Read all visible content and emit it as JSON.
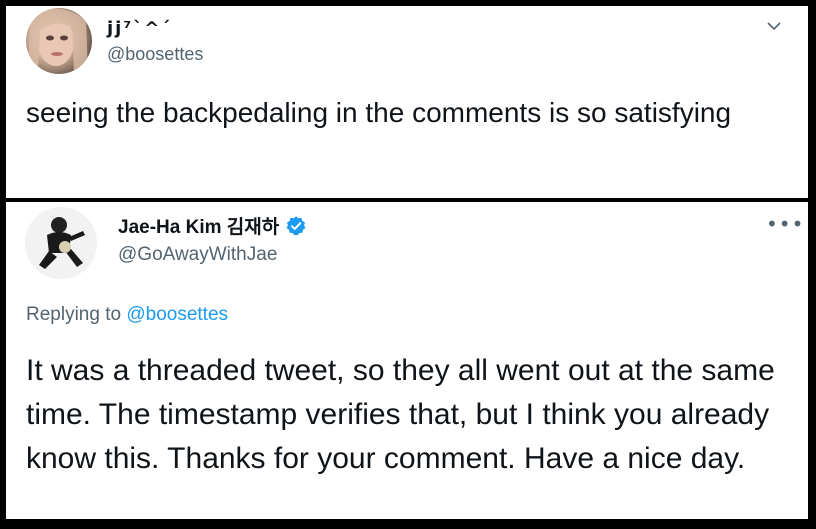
{
  "top_tweet": {
    "display_name": "jj⁷`^´",
    "handle": "@boosettes",
    "text": "seeing the backpedaling in the comments is so satisfying",
    "menu_icon": "chevron-down-icon"
  },
  "reply_tweet": {
    "display_name": "Jae-Ha Kim 김재하",
    "handle": "@GoAwayWithJae",
    "verified": true,
    "more_icon": "more-icon",
    "replying_prefix": "Replying to",
    "replying_mention": "@boosettes",
    "text": "It was a threaded tweet, so they all went out at the same time. The timestamp verifies that, but I think you already know this. Thanks for your comment. Have a nice day."
  },
  "colors": {
    "text_primary": "#0f1419",
    "text_secondary": "#536471",
    "accent": "#1d9bf0",
    "border": "#000000"
  }
}
